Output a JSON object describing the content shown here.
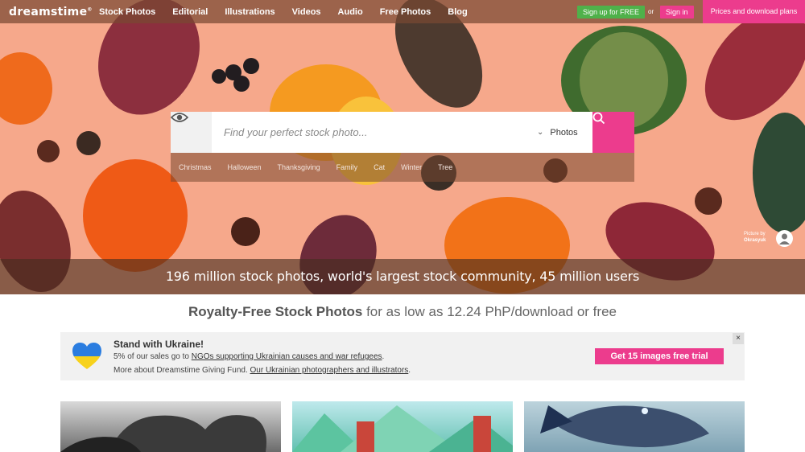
{
  "brand": {
    "logo": "dreamstime"
  },
  "nav": {
    "items": [
      "Stock Photos",
      "Editorial",
      "Illustrations",
      "Videos",
      "Audio",
      "Free Photos",
      "Blog"
    ],
    "signup_label": "Sign up for FREE",
    "or_label": "or",
    "signin_label": "Sign in",
    "prices_label": "Prices and download plans"
  },
  "search": {
    "placeholder": "Find your perfect stock photo...",
    "type_selected": "Photos",
    "tags": [
      "Christmas",
      "Halloween",
      "Thanksgiving",
      "Family",
      "Cat",
      "Winter",
      "Tree"
    ]
  },
  "hero": {
    "credit_prefix": "Picture by",
    "credit_author": "Okrasyuk",
    "banner": "196 million stock photos, world's largest stock community, 45 million users"
  },
  "subtitle": {
    "bold": "Royalty-Free Stock Photos",
    "rest": " for as low as 12.24 PhP/download or free"
  },
  "ukraine": {
    "title": "Stand with Ukraine!",
    "line1_prefix": "5% of our sales go to ",
    "line1_link": "NGOs supporting Ukrainian causes and war refugees",
    "line1_suffix": ".",
    "line2_prefix": "More about Dreamstime Giving Fund. ",
    "line2_link": "Our Ukrainian photographers and illustrators",
    "line2_suffix": ".",
    "trial_label": "Get 15 images free trial",
    "close_label": "×"
  },
  "colors": {
    "accent": "#ec3c8d",
    "signup": "#4fb14a",
    "hero_bg": "#f6a88b"
  },
  "icons": [
    "eye-icon",
    "search-icon",
    "chevron-down-icon",
    "close-icon",
    "heart-icon"
  ]
}
